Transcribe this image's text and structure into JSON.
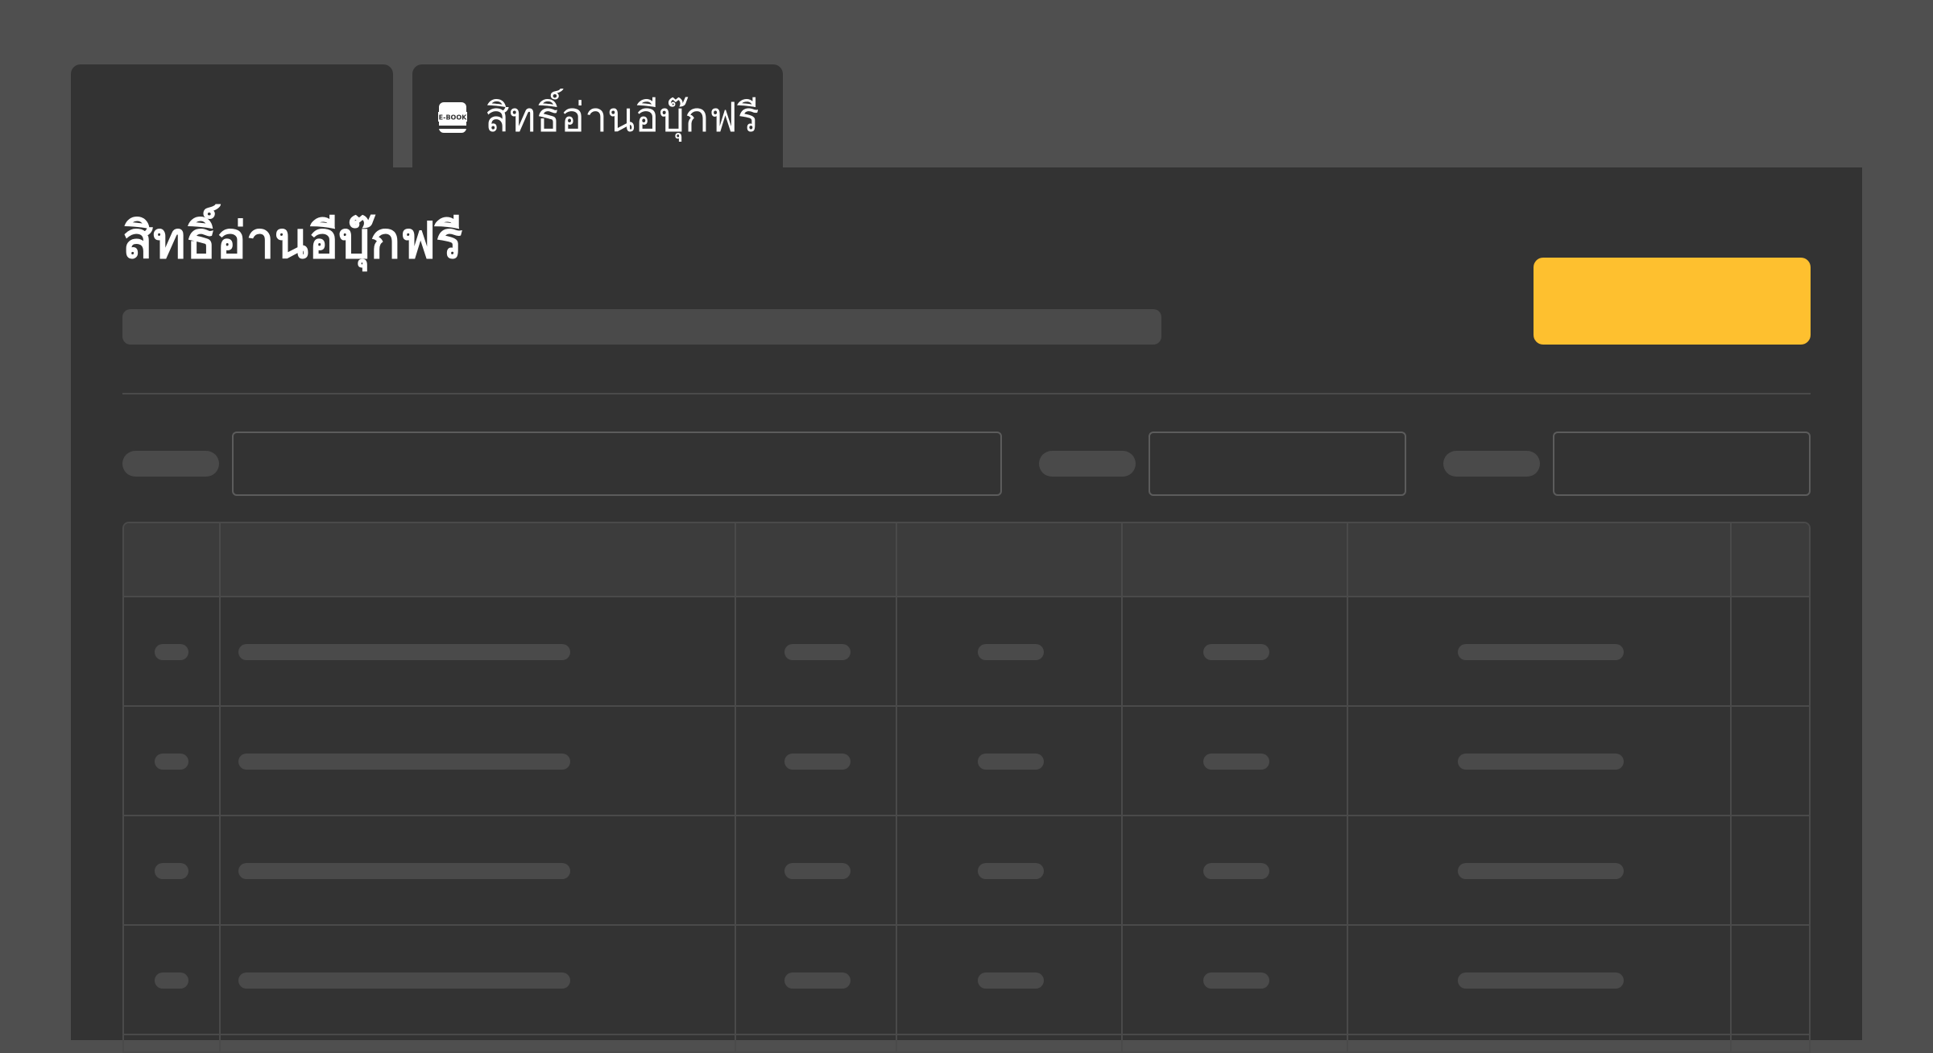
{
  "tabs": {
    "active": {
      "label": "สิทธิ์อ่านอีบุ๊กฟรี",
      "icon": "ebook-icon",
      "icon_text": "E-BOOK"
    }
  },
  "page": {
    "title": "สิทธิ์อ่านอีบุ๊กฟรี"
  },
  "filters": {
    "search": {
      "value": "",
      "placeholder": ""
    },
    "filter_1": {
      "value": "",
      "placeholder": ""
    },
    "filter_2": {
      "value": "",
      "placeholder": ""
    }
  },
  "colors": {
    "background": "#4f4f4f",
    "panel": "#333333",
    "accent": "#fec02f",
    "skeleton": "#4a4a4a"
  },
  "table": {
    "columns": 7,
    "rows": 4
  }
}
